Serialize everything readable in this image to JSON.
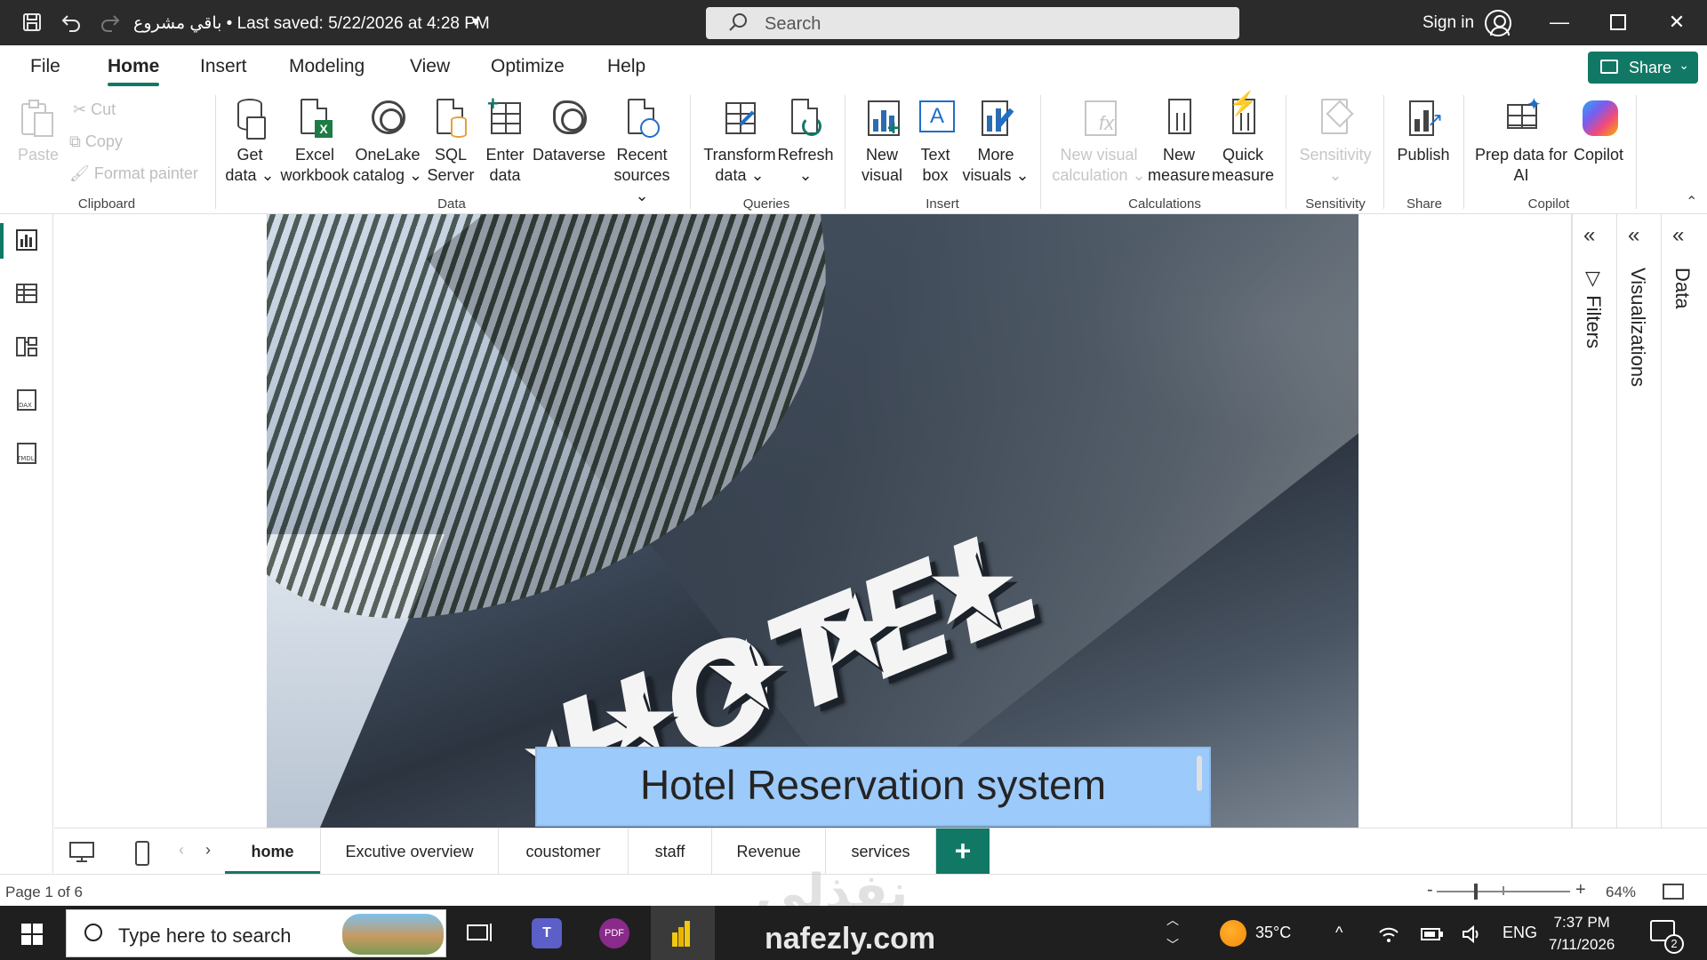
{
  "titlebar": {
    "title": "باقي مشروع • Last saved: 5/22/2026 at 4:28 PM",
    "search_placeholder": "Search",
    "signin": "Sign in"
  },
  "menu": {
    "items": [
      "File",
      "Home",
      "Insert",
      "Modeling",
      "View",
      "Optimize",
      "Help"
    ],
    "active": "Home",
    "share_label": "Share"
  },
  "ribbon": {
    "clipboard": {
      "paste": "Paste",
      "cut": "Cut",
      "copy": "Copy",
      "format_painter": "Format painter",
      "label": "Clipboard"
    },
    "data": {
      "get_data": [
        "Get",
        "data"
      ],
      "excel_workbook": [
        "Excel",
        "workbook"
      ],
      "onelake_catalog": [
        "OneLake",
        "catalog"
      ],
      "sql_server": [
        "SQL",
        "Server"
      ],
      "enter_data": [
        "Enter",
        "data"
      ],
      "dataverse": "Dataverse",
      "recent_sources": [
        "Recent",
        "sources"
      ],
      "label": "Data"
    },
    "queries": {
      "transform_data": [
        "Transform",
        "data"
      ],
      "refresh": "Refresh",
      "label": "Queries"
    },
    "insert": {
      "new_visual": [
        "New",
        "visual"
      ],
      "text_box": [
        "Text",
        "box"
      ],
      "more_visuals": [
        "More",
        "visuals"
      ],
      "label": "Insert"
    },
    "calculations": {
      "new_visual_calculation": [
        "New visual",
        "calculation"
      ],
      "new_measure": [
        "New",
        "measure"
      ],
      "quick_measure": [
        "Quick",
        "measure"
      ],
      "label": "Calculations"
    },
    "sensitivity": {
      "sensitivity": "Sensitivity",
      "label": "Sensitivity"
    },
    "share": {
      "publish": "Publish",
      "label": "Share"
    },
    "copilot": {
      "prep_data": [
        "Prep data for",
        "AI"
      ],
      "copilot": "Copilot",
      "label": "Copilot"
    }
  },
  "canvas": {
    "hero_text": "HOTEL",
    "title": "Hotel Reservation system"
  },
  "right_panes": {
    "filters": "Filters",
    "visualizations": "Visualizations",
    "data": "Data"
  },
  "pages": {
    "tabs": [
      "home",
      "Excutive overview",
      "coustomer",
      "staff",
      "Revenue",
      "services"
    ],
    "active": "home",
    "add_label": "+"
  },
  "status": {
    "page_indicator": "Page 1 of 6",
    "zoom_minus": "-",
    "zoom_plus": "+",
    "zoom_level": "64%"
  },
  "watermark": {
    "arabic": "نفذلي",
    "site": "nafezly.com"
  },
  "taskbar": {
    "search_placeholder": "Type here to search",
    "temperature": "35°C",
    "language": "ENG",
    "time": "7:37 PM",
    "date": "7/11/2026",
    "notification_count": "2"
  },
  "colors": {
    "accent": "#117865",
    "title_box": "#9ccafb",
    "titlebar": "#2b2b2b",
    "taskbar": "#1f1f1f"
  },
  "icons": [
    "save-icon",
    "undo-icon",
    "redo-icon",
    "search-icon",
    "user-icon",
    "minimize-icon",
    "maximize-icon",
    "close-icon",
    "share-icon",
    "paste-icon",
    "cut-icon",
    "copy-icon",
    "format-painter-icon",
    "report-view-icon",
    "table-view-icon",
    "model-view-icon",
    "dax-query-icon",
    "tmdl-icon",
    "filter-icon",
    "desktop-layout-icon",
    "mobile-layout-icon",
    "windows-icon",
    "weather-icon",
    "wifi-icon",
    "battery-icon",
    "volume-icon",
    "notification-icon"
  ]
}
